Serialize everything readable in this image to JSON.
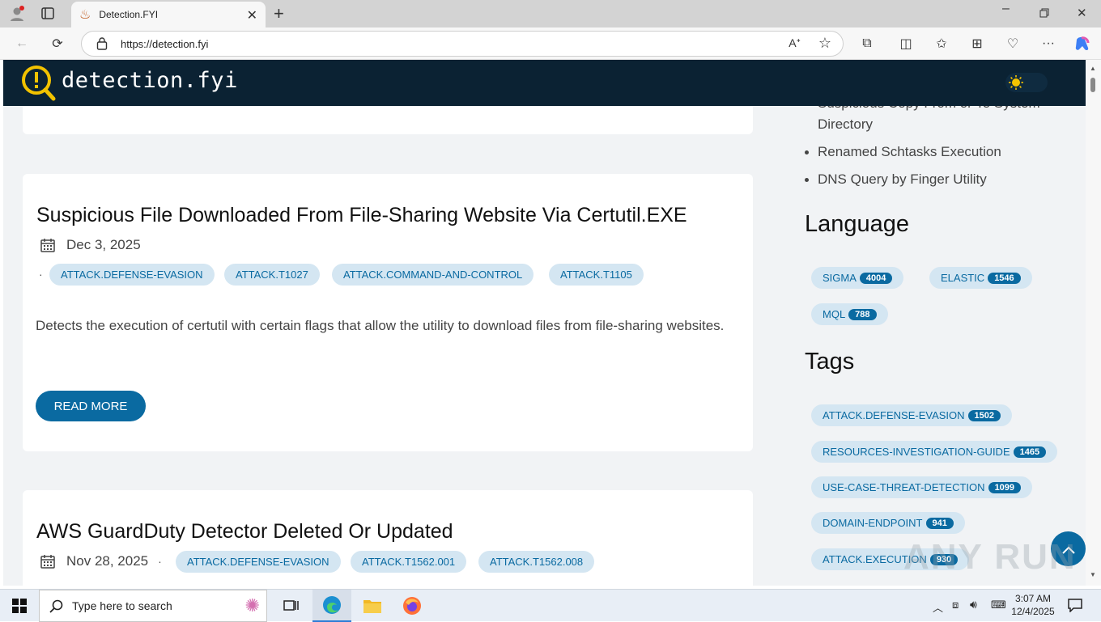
{
  "browser": {
    "tab_title": "Detection.FYI",
    "url": "https://detection.fyi"
  },
  "site": {
    "logo_text": "detection.fyi"
  },
  "cards": [
    {
      "title": "Suspicious File Downloaded From File-Sharing Website Via Certutil.EXE",
      "date": "Dec 3, 2025",
      "tags": [
        "ATTACK.DEFENSE-EVASION",
        "ATTACK.T1027",
        "ATTACK.COMMAND-AND-CONTROL",
        "ATTACK.T1105"
      ],
      "description": "Detects the execution of certutil with certain flags that allow the utility to download files from file-sharing websites.",
      "read_more": "READ MORE"
    },
    {
      "title": "AWS GuardDuty Detector Deleted Or Updated",
      "date": "Nov 28, 2025",
      "tags": [
        "ATTACK.DEFENSE-EVASION",
        "ATTACK.T1562.001",
        "ATTACK.T1562.008"
      ]
    }
  ],
  "bullet_sep": "·",
  "sidebar": {
    "recent_items": [
      "Suspicious Copy From or To System Directory",
      "Renamed Schtasks Execution",
      "DNS Query by Finger Utility"
    ],
    "language_heading": "Language",
    "languages": [
      {
        "label": "SIGMA",
        "count": "4004"
      },
      {
        "label": "ELASTIC",
        "count": "1546"
      },
      {
        "label": "MQL",
        "count": "788"
      }
    ],
    "tags_heading": "Tags",
    "tags": [
      {
        "label": "ATTACK.DEFENSE-EVASION",
        "count": "1502"
      },
      {
        "label": "RESOURCES-INVESTIGATION-GUIDE",
        "count": "1465"
      },
      {
        "label": "USE-CASE-THREAT-DETECTION",
        "count": "1099"
      },
      {
        "label": "DOMAIN-ENDPOINT",
        "count": "941"
      },
      {
        "label": "ATTACK.EXECUTION",
        "count": "930"
      }
    ]
  },
  "taskbar": {
    "search_placeholder": "Type here to search",
    "time": "3:07 AM",
    "date": "12/4/2025"
  },
  "watermark": "ANY RUN",
  "colors": {
    "header_bg": "#0b2233",
    "accent": "#0a6aa1",
    "chip_bg": "#d4e6f2",
    "page_bg": "#f1f3f5"
  }
}
